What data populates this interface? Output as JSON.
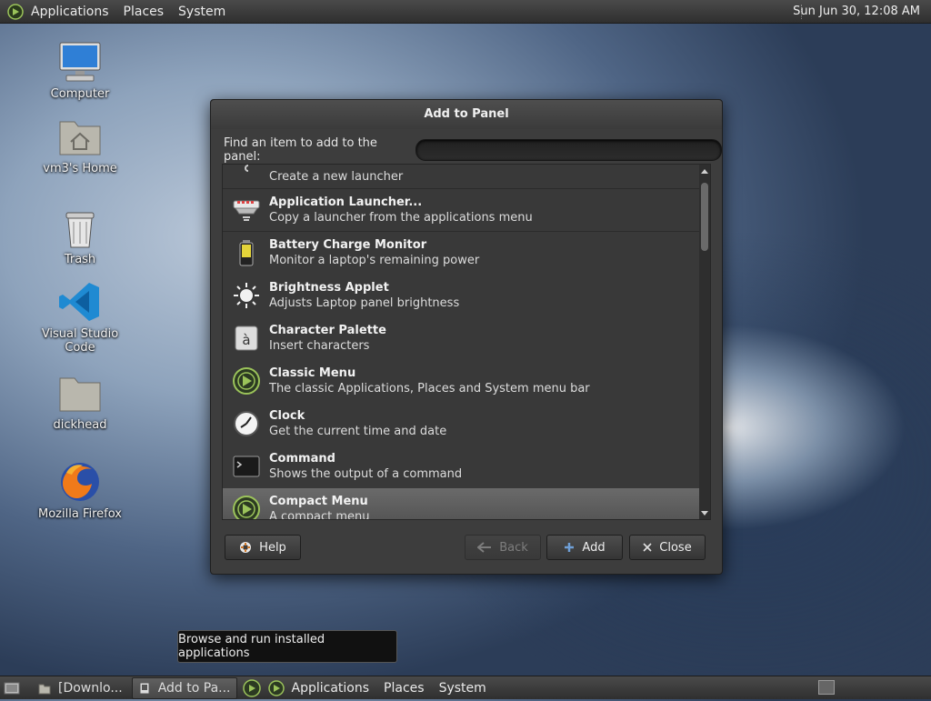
{
  "top_panel": {
    "menus": [
      "Applications",
      "Places",
      "System"
    ],
    "clock": "Sun Jun 30, 12:08 AM"
  },
  "desktop_icons": [
    {
      "label": "Computer",
      "icon": "computer-icon"
    },
    {
      "label": "vm3's Home",
      "icon": "home-folder-icon"
    },
    {
      "label": "Trash",
      "icon": "trash-icon"
    },
    {
      "label": "Visual Studio Code",
      "icon": "vscode-icon"
    },
    {
      "label": "dickhead",
      "icon": "folder-icon"
    },
    {
      "label": "Mozilla Firefox",
      "icon": "firefox-icon"
    }
  ],
  "dialog": {
    "title": "Add to Panel",
    "find_label": "Find an item to add to the panel:",
    "search_value": "",
    "items": [
      {
        "name": "",
        "desc": "Create a new launcher",
        "icon": "launcher-icon"
      },
      {
        "name": "Application Launcher...",
        "desc": "Copy a launcher from the applications menu",
        "icon": "app-launcher-icon"
      },
      {
        "name": "Battery Charge Monitor",
        "desc": "Monitor a laptop's remaining power",
        "icon": "battery-icon"
      },
      {
        "name": "Brightness Applet",
        "desc": "Adjusts Laptop panel brightness",
        "icon": "brightness-icon"
      },
      {
        "name": "Character Palette",
        "desc": "Insert characters",
        "icon": "character-palette-icon"
      },
      {
        "name": "Classic Menu",
        "desc": "The classic Applications, Places and System menu bar",
        "icon": "menu-icon"
      },
      {
        "name": "Clock",
        "desc": "Get the current time and date",
        "icon": "clock-icon"
      },
      {
        "name": "Command",
        "desc": "Shows the output of a command",
        "icon": "terminal-icon"
      },
      {
        "name": "Compact Menu",
        "desc": "A compact menu",
        "icon": "menu-icon"
      }
    ],
    "buttons": {
      "help": "Help",
      "back": "Back",
      "add": "Add",
      "close": "Close"
    }
  },
  "tooltip": "Browse and run installed applications",
  "bottom_panel": {
    "tasks": [
      "[Downlo...",
      "Add to Pa..."
    ],
    "menus": [
      "Applications",
      "Places",
      "System"
    ]
  }
}
